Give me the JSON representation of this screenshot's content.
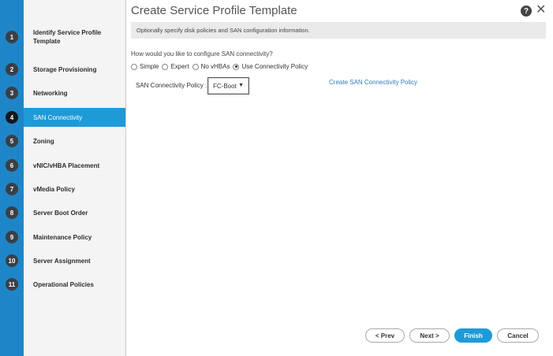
{
  "dialog": {
    "title": "Create Service Profile Template",
    "info": "Optionally specify disk policies and SAN configuration information."
  },
  "steps": [
    {
      "num": "1",
      "label": "Identify Service Profile Template"
    },
    {
      "num": "2",
      "label": "Storage Provisioning"
    },
    {
      "num": "3",
      "label": "Networking"
    },
    {
      "num": "4",
      "label": "SAN Connectivity",
      "active": true
    },
    {
      "num": "5",
      "label": "Zoning"
    },
    {
      "num": "6",
      "label": "vNIC/vHBA Placement"
    },
    {
      "num": "7",
      "label": "vMedia Policy"
    },
    {
      "num": "8",
      "label": "Server Boot Order"
    },
    {
      "num": "9",
      "label": "Maintenance Policy"
    },
    {
      "num": "10",
      "label": "Server Assignment"
    },
    {
      "num": "11",
      "label": "Operational Policies"
    }
  ],
  "san": {
    "question": "How would you like to configure SAN connectivity?",
    "options": [
      "Simple",
      "Expert",
      "No vHBAs",
      "Use Connectivity Policy"
    ],
    "selected_option": "Use Connectivity Policy",
    "policy_label": "SAN Connectivity Policy :",
    "policy_value": "FC-Boot",
    "create_link": "Create SAN Connectivity Policy"
  },
  "buttons": {
    "prev": "< Prev",
    "next": "Next >",
    "finish": "Finish",
    "cancel": "Cancel"
  },
  "icons": {
    "help": "help-icon",
    "close": "close-icon",
    "dropdown": "caret-down-icon"
  },
  "colors": {
    "accent": "#1e9bd7",
    "left_rail": "#1e86c8",
    "link": "#2a7fc0"
  }
}
